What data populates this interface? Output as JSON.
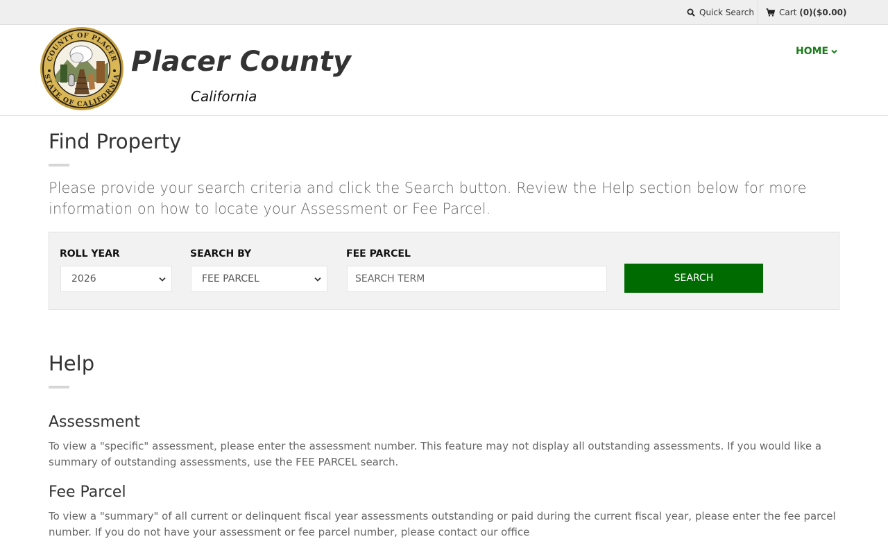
{
  "topbar": {
    "quick_search_label": "Quick Search",
    "cart_label": "Cart",
    "cart_count": "(0)",
    "cart_total": "($0.00)"
  },
  "header": {
    "title": "Placer County",
    "subtitle": "California",
    "seal_text_top": "COUNTY OF PLACER",
    "seal_text_bottom": "STATE OF CALIFORNIA"
  },
  "nav": {
    "home_label": "HOME"
  },
  "main": {
    "page_title": "Find Property",
    "intro": "Please provide your search criteria and click the Search button. Review the Help section below for more information on how to locate your Assessment or Fee Parcel."
  },
  "search": {
    "roll_year_label": "ROLL YEAR",
    "roll_year_value": "2026",
    "search_by_label": "SEARCH BY",
    "search_by_value": "FEE PARCEL",
    "term_label": "FEE PARCEL",
    "term_placeholder": "SEARCH TERM",
    "button_label": "SEARCH"
  },
  "help": {
    "title": "Help",
    "sections": [
      {
        "heading": "Assessment",
        "text": "To view a \"specific\" assessment, please enter the assessment number. This feature may not display all outstanding assessments. If you would like a summary of outstanding assessments, use the FEE PARCEL search."
      },
      {
        "heading": "Fee Parcel",
        "text": "To view a \"summary\" of all current or delinquent fiscal year assessments outstanding or paid during the current fiscal year, please enter the fee parcel number. If you do not have your assessment or fee parcel number, please contact our office"
      }
    ]
  },
  "colors": {
    "accent_green": "#006b00",
    "nav_green": "#1a7a1a",
    "seal_gold": "#c8a040",
    "topbar_bg": "#efefef",
    "panel_bg": "#f2f2f2"
  },
  "icons": {
    "quick_search": "search-icon",
    "cart": "cart-icon",
    "home_dropdown": "chevron-down-icon",
    "select_caret": "chevron-down-icon"
  }
}
